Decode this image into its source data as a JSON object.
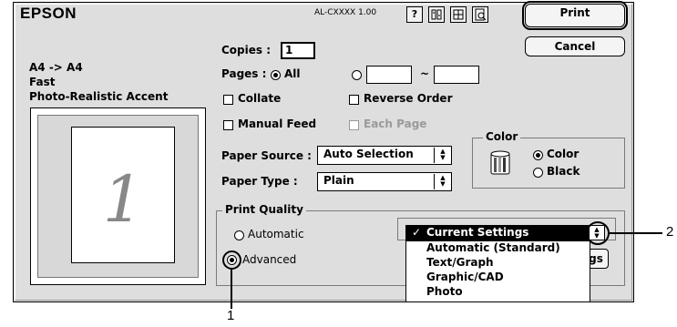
{
  "header": {
    "brand": "EPSON",
    "model": "AL-CXXXX 1.00",
    "icons": [
      "help-icon",
      "printer-utility-icon",
      "layout-icon",
      "preview-icon"
    ],
    "print_label": "Print",
    "cancel_label": "Cancel"
  },
  "preview": {
    "paper_line": "A4 -> A4",
    "quality_line": "Fast",
    "mode_line": "Photo-Realistic Accent",
    "page_number": "1"
  },
  "copies": {
    "label": "Copies :",
    "value": "1"
  },
  "pages": {
    "label": "Pages :",
    "all_label": "All",
    "all_selected": true,
    "from": "",
    "separator": "~",
    "to": ""
  },
  "options": {
    "collate": "Collate",
    "reverse_order": "Reverse Order",
    "manual_feed": "Manual Feed",
    "each_page": "Each Page"
  },
  "color_group": {
    "title": "Color",
    "color_label": "Color",
    "black_label": "Black",
    "selected": "Color"
  },
  "paper_source": {
    "label": "Paper Source :",
    "value": "Auto Selection"
  },
  "paper_type": {
    "label": "Paper Type :",
    "value": "Plain"
  },
  "print_quality": {
    "title": "Print Quality",
    "automatic_label": "Automatic",
    "advanced_label": "Advanced",
    "selected": "Advanced",
    "button_partial": "gs"
  },
  "settings_menu": {
    "check_mark": "✓",
    "items": [
      "Current Settings",
      "Automatic (Standard)",
      "Text/Graph",
      "Graphic/CAD",
      "Photo"
    ],
    "selected": "Current Settings"
  },
  "callouts": {
    "one": "1",
    "two": "2"
  },
  "colors": {
    "window_bg": "#dedede",
    "field_bg": "#ffffff",
    "selection": "#000000"
  }
}
